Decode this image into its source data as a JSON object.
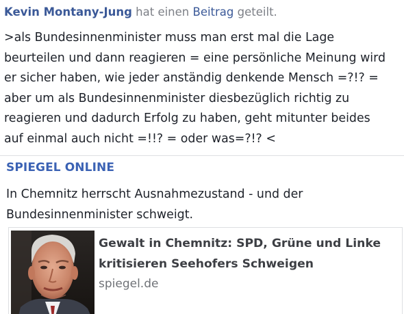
{
  "post": {
    "author": "Kevin Montany-Jung",
    "action_pre": "hat einen",
    "action_link": "Beitrag",
    "action_post": "geteilt.",
    "text_lines": [
      ">als Bundesinnenminister muss man erst mal die Lage",
      "beurteilen und dann reagieren = eine persönliche Meinung wird",
      "er sicher haben, wie jeder anständig denkende Mensch =?!? =",
      "aber um als Bundesinnenminister diesbezüglich richtig zu",
      "reagieren und dadurch Erfolg zu haben, geht mitunter beides",
      "auf einmal auch nicht =!!? = oder was=?!? <"
    ]
  },
  "shared": {
    "page_name": "SPIEGEL ONLINE",
    "text_lines": [
      "In Chemnitz herrscht Ausnahmezustand - und der",
      "Bundesinnenminister schweigt."
    ],
    "link": {
      "title_lines": [
        "Gewalt in Chemnitz: SPD, Grüne und Linke",
        "kritisieren Seehofers Schweigen"
      ],
      "domain": "spiegel.de"
    }
  },
  "colors": {
    "link_blue": "#3b5998",
    "page_blue": "#3b62b4",
    "text": "#1d2129",
    "muted": "#7c7f86"
  }
}
